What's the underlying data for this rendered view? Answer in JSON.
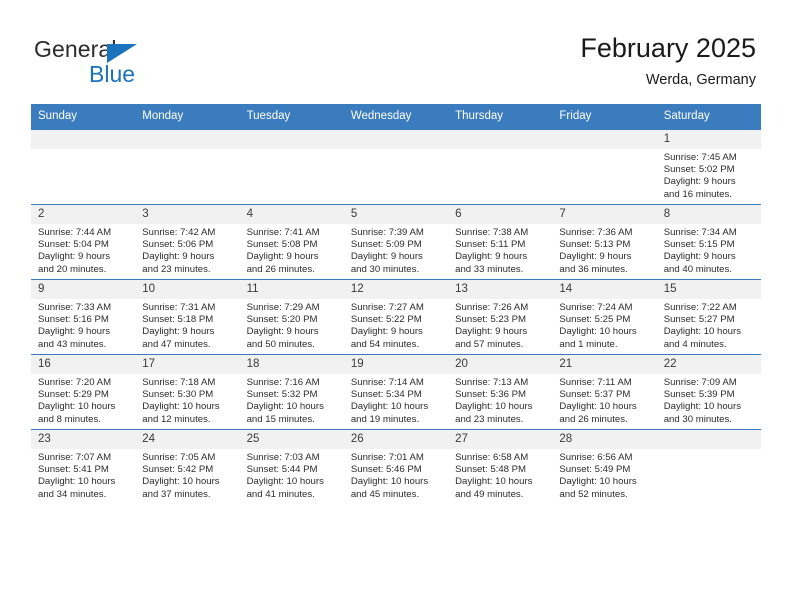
{
  "brand": {
    "name_part1": "General",
    "name_part2": "Blue",
    "accent_color": "#1b72bd"
  },
  "header": {
    "title": "February 2025",
    "subtitle": "Werda, Germany"
  },
  "calendar": {
    "header_bg": "#3a7cbe",
    "weekdays": [
      "Sunday",
      "Monday",
      "Tuesday",
      "Wednesday",
      "Thursday",
      "Friday",
      "Saturday"
    ],
    "labels": {
      "sunrise": "Sunrise:",
      "sunset": "Sunset:",
      "daylight": "Daylight:"
    },
    "weeks": [
      [
        {
          "day": "",
          "blank": true
        },
        {
          "day": "",
          "blank": true
        },
        {
          "day": "",
          "blank": true
        },
        {
          "day": "",
          "blank": true
        },
        {
          "day": "",
          "blank": true
        },
        {
          "day": "",
          "blank": true
        },
        {
          "day": "1",
          "sunrise": "Sunrise: 7:45 AM",
          "sunset": "Sunset: 5:02 PM",
          "daylight_line1": "Daylight: 9 hours",
          "daylight_line2": "and 16 minutes."
        }
      ],
      [
        {
          "day": "2",
          "sunrise": "Sunrise: 7:44 AM",
          "sunset": "Sunset: 5:04 PM",
          "daylight_line1": "Daylight: 9 hours",
          "daylight_line2": "and 20 minutes."
        },
        {
          "day": "3",
          "sunrise": "Sunrise: 7:42 AM",
          "sunset": "Sunset: 5:06 PM",
          "daylight_line1": "Daylight: 9 hours",
          "daylight_line2": "and 23 minutes."
        },
        {
          "day": "4",
          "sunrise": "Sunrise: 7:41 AM",
          "sunset": "Sunset: 5:08 PM",
          "daylight_line1": "Daylight: 9 hours",
          "daylight_line2": "and 26 minutes."
        },
        {
          "day": "5",
          "sunrise": "Sunrise: 7:39 AM",
          "sunset": "Sunset: 5:09 PM",
          "daylight_line1": "Daylight: 9 hours",
          "daylight_line2": "and 30 minutes."
        },
        {
          "day": "6",
          "sunrise": "Sunrise: 7:38 AM",
          "sunset": "Sunset: 5:11 PM",
          "daylight_line1": "Daylight: 9 hours",
          "daylight_line2": "and 33 minutes."
        },
        {
          "day": "7",
          "sunrise": "Sunrise: 7:36 AM",
          "sunset": "Sunset: 5:13 PM",
          "daylight_line1": "Daylight: 9 hours",
          "daylight_line2": "and 36 minutes."
        },
        {
          "day": "8",
          "sunrise": "Sunrise: 7:34 AM",
          "sunset": "Sunset: 5:15 PM",
          "daylight_line1": "Daylight: 9 hours",
          "daylight_line2": "and 40 minutes."
        }
      ],
      [
        {
          "day": "9",
          "sunrise": "Sunrise: 7:33 AM",
          "sunset": "Sunset: 5:16 PM",
          "daylight_line1": "Daylight: 9 hours",
          "daylight_line2": "and 43 minutes."
        },
        {
          "day": "10",
          "sunrise": "Sunrise: 7:31 AM",
          "sunset": "Sunset: 5:18 PM",
          "daylight_line1": "Daylight: 9 hours",
          "daylight_line2": "and 47 minutes."
        },
        {
          "day": "11",
          "sunrise": "Sunrise: 7:29 AM",
          "sunset": "Sunset: 5:20 PM",
          "daylight_line1": "Daylight: 9 hours",
          "daylight_line2": "and 50 minutes."
        },
        {
          "day": "12",
          "sunrise": "Sunrise: 7:27 AM",
          "sunset": "Sunset: 5:22 PM",
          "daylight_line1": "Daylight: 9 hours",
          "daylight_line2": "and 54 minutes."
        },
        {
          "day": "13",
          "sunrise": "Sunrise: 7:26 AM",
          "sunset": "Sunset: 5:23 PM",
          "daylight_line1": "Daylight: 9 hours",
          "daylight_line2": "and 57 minutes."
        },
        {
          "day": "14",
          "sunrise": "Sunrise: 7:24 AM",
          "sunset": "Sunset: 5:25 PM",
          "daylight_line1": "Daylight: 10 hours",
          "daylight_line2": "and 1 minute."
        },
        {
          "day": "15",
          "sunrise": "Sunrise: 7:22 AM",
          "sunset": "Sunset: 5:27 PM",
          "daylight_line1": "Daylight: 10 hours",
          "daylight_line2": "and 4 minutes."
        }
      ],
      [
        {
          "day": "16",
          "sunrise": "Sunrise: 7:20 AM",
          "sunset": "Sunset: 5:29 PM",
          "daylight_line1": "Daylight: 10 hours",
          "daylight_line2": "and 8 minutes."
        },
        {
          "day": "17",
          "sunrise": "Sunrise: 7:18 AM",
          "sunset": "Sunset: 5:30 PM",
          "daylight_line1": "Daylight: 10 hours",
          "daylight_line2": "and 12 minutes."
        },
        {
          "day": "18",
          "sunrise": "Sunrise: 7:16 AM",
          "sunset": "Sunset: 5:32 PM",
          "daylight_line1": "Daylight: 10 hours",
          "daylight_line2": "and 15 minutes."
        },
        {
          "day": "19",
          "sunrise": "Sunrise: 7:14 AM",
          "sunset": "Sunset: 5:34 PM",
          "daylight_line1": "Daylight: 10 hours",
          "daylight_line2": "and 19 minutes."
        },
        {
          "day": "20",
          "sunrise": "Sunrise: 7:13 AM",
          "sunset": "Sunset: 5:36 PM",
          "daylight_line1": "Daylight: 10 hours",
          "daylight_line2": "and 23 minutes."
        },
        {
          "day": "21",
          "sunrise": "Sunrise: 7:11 AM",
          "sunset": "Sunset: 5:37 PM",
          "daylight_line1": "Daylight: 10 hours",
          "daylight_line2": "and 26 minutes."
        },
        {
          "day": "22",
          "sunrise": "Sunrise: 7:09 AM",
          "sunset": "Sunset: 5:39 PM",
          "daylight_line1": "Daylight: 10 hours",
          "daylight_line2": "and 30 minutes."
        }
      ],
      [
        {
          "day": "23",
          "sunrise": "Sunrise: 7:07 AM",
          "sunset": "Sunset: 5:41 PM",
          "daylight_line1": "Daylight: 10 hours",
          "daylight_line2": "and 34 minutes."
        },
        {
          "day": "24",
          "sunrise": "Sunrise: 7:05 AM",
          "sunset": "Sunset: 5:42 PM",
          "daylight_line1": "Daylight: 10 hours",
          "daylight_line2": "and 37 minutes."
        },
        {
          "day": "25",
          "sunrise": "Sunrise: 7:03 AM",
          "sunset": "Sunset: 5:44 PM",
          "daylight_line1": "Daylight: 10 hours",
          "daylight_line2": "and 41 minutes."
        },
        {
          "day": "26",
          "sunrise": "Sunrise: 7:01 AM",
          "sunset": "Sunset: 5:46 PM",
          "daylight_line1": "Daylight: 10 hours",
          "daylight_line2": "and 45 minutes."
        },
        {
          "day": "27",
          "sunrise": "Sunrise: 6:58 AM",
          "sunset": "Sunset: 5:48 PM",
          "daylight_line1": "Daylight: 10 hours",
          "daylight_line2": "and 49 minutes."
        },
        {
          "day": "28",
          "sunrise": "Sunrise: 6:56 AM",
          "sunset": "Sunset: 5:49 PM",
          "daylight_line1": "Daylight: 10 hours",
          "daylight_line2": "and 52 minutes."
        },
        {
          "day": "",
          "blank": true
        }
      ]
    ]
  }
}
